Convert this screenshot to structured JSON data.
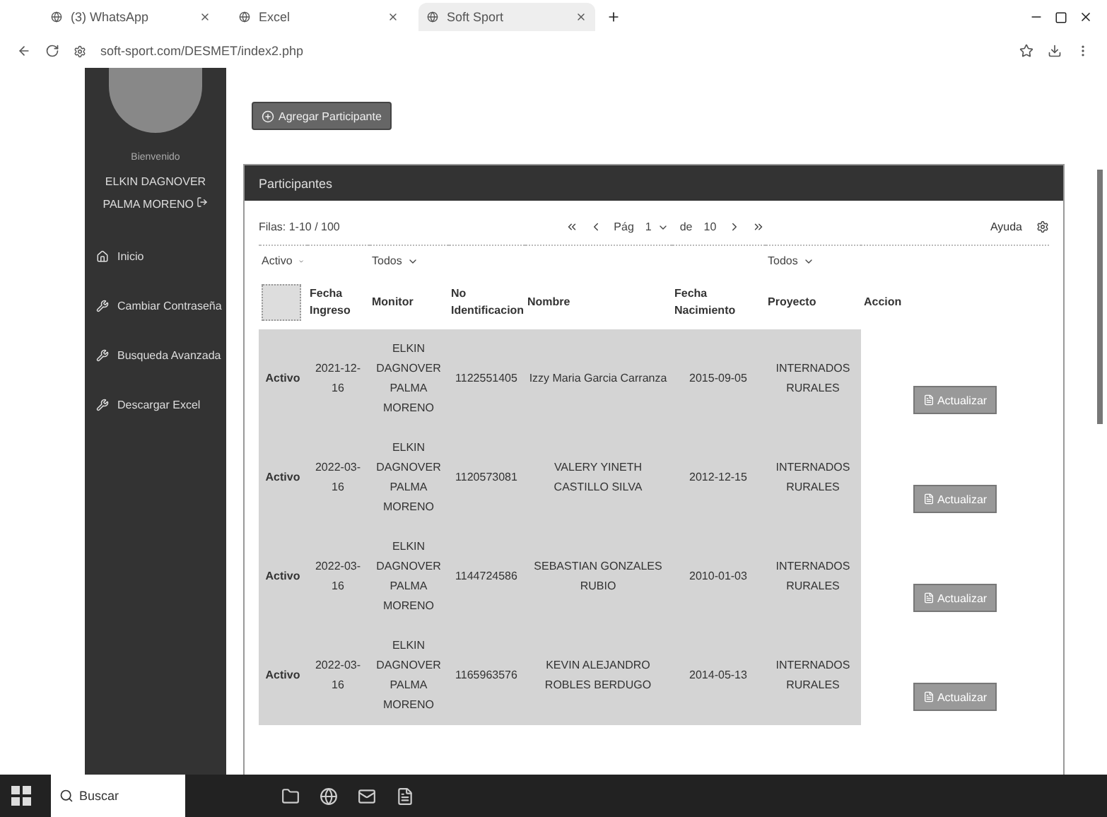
{
  "browser": {
    "tabs": [
      {
        "title": "(3) WhatsApp",
        "selected": false
      },
      {
        "title": "Excel",
        "selected": false
      },
      {
        "title": "Soft Sport",
        "selected": true
      }
    ],
    "url": "soft-sport.com/DESMET/index2.php"
  },
  "sidebar": {
    "greeting": "Bienvenido",
    "user": "ELKIN DAGNOVER PALMA MORENO",
    "items": [
      {
        "label": "Inicio",
        "kind": "home"
      },
      {
        "label": "Cambiar Contraseña",
        "kind": "tool"
      },
      {
        "label": "Busqueda Avanzada",
        "kind": "tool"
      },
      {
        "label": "Descargar Excel",
        "kind": "tool"
      }
    ]
  },
  "add_button": "Agregar Participante",
  "panel": {
    "title": "Participantes",
    "rows_info": "Filas: 1-10 / 100",
    "pager": {
      "page_label": "Pág",
      "page": "1",
      "of_label": "de",
      "total": "10"
    },
    "help": "Ayuda",
    "select_all_checked": false,
    "columns": [
      {
        "filter": "Activo"
      },
      {
        "label": "Fecha Ingreso"
      },
      {
        "label": "Monitor",
        "filter": "Todos"
      },
      {
        "label": "No Identificacion"
      },
      {
        "label": "Nombre"
      },
      {
        "label": "Fecha Nacimiento"
      },
      {
        "label": "Proyecto",
        "filter": "Todos"
      },
      {
        "label": "Accion"
      }
    ],
    "rows": [
      {
        "estado": "Activo",
        "ingreso": "2021-12-16",
        "monitor": "ELKIN DAGNOVER PALMA MORENO",
        "id": "1122551405",
        "nombre": "Izzy Maria Garcia Carranza",
        "nacimiento": "2015-09-05",
        "proyecto": "INTERNADOS RURALES",
        "action": "Actualizar"
      },
      {
        "estado": "Activo",
        "ingreso": "2022-03-16",
        "monitor": "ELKIN DAGNOVER PALMA MORENO",
        "id": "1120573081",
        "nombre": "VALERY YINETH CASTILLO SILVA",
        "nacimiento": "2012-12-15",
        "proyecto": "INTERNADOS RURALES",
        "action": "Actualizar"
      },
      {
        "estado": "Activo",
        "ingreso": "2022-03-16",
        "monitor": "ELKIN DAGNOVER PALMA MORENO",
        "id": "1144724586",
        "nombre": "SEBASTIAN GONZALES RUBIO",
        "nacimiento": "2010-01-03",
        "proyecto": "INTERNADOS RURALES",
        "action": "Actualizar"
      },
      {
        "estado": "Activo",
        "ingreso": "2022-03-16",
        "monitor": "ELKIN DAGNOVER PALMA MORENO",
        "id": "1165963576",
        "nombre": "KEVIN ALEJANDRO ROBLES BERDUGO",
        "nacimiento": "2014-05-13",
        "proyecto": "INTERNADOS RURALES",
        "action": "Actualizar"
      }
    ]
  },
  "taskbar": {
    "search": "Buscar"
  }
}
